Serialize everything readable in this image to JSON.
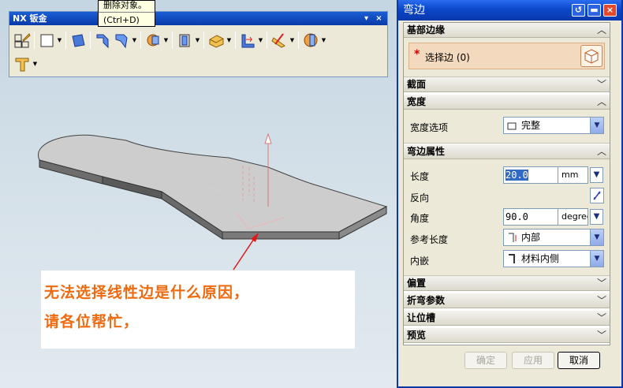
{
  "tooltip": {
    "line1": "删除对象。",
    "line2": "(Ctrl+D)"
  },
  "toolbar": {
    "title": "NX 钣金",
    "controls": [
      "▾",
      "×"
    ],
    "row1_icons": [
      "sketch-icon",
      "tab-icon",
      "flange-icon",
      "contour-flange-icon",
      "lofted-flange-icon",
      "bend-icon",
      "jog-icon",
      "hem-flange-icon",
      "gusset-icon",
      "unbend-icon",
      "rebend-icon",
      "solid-punch-icon"
    ],
    "row2_icons": [
      "convert-sheet-metal-icon"
    ]
  },
  "annotation": {
    "line1": "无法选择线性边是什么原因，",
    "line2": "请各位帮忙，"
  },
  "dialog": {
    "title": "弯边",
    "controls": {
      "reset": "↺",
      "min": "▬",
      "close": "×"
    },
    "sections": {
      "base_edge": {
        "header": "基部边缘",
        "select_edge": "选择边 (0)",
        "required_mark": "*"
      },
      "section": {
        "header": "截面"
      },
      "width": {
        "header": "宽度",
        "option_label": "宽度选项",
        "option_value": "完整"
      },
      "flange_properties": {
        "header": "弯边属性",
        "length_label": "长度",
        "length_value": "20.0",
        "length_unit": "mm",
        "reverse_label": "反向",
        "angle_label": "角度",
        "angle_value": "90.0",
        "angle_unit": "degree",
        "ref_length_label": "参考长度",
        "ref_length_value": "内部",
        "inset_label": "内嵌",
        "inset_value": "材料内侧"
      },
      "offset": {
        "header": "偏置"
      },
      "bend_params": {
        "header": "折弯参数"
      },
      "relief": {
        "header": "让位槽"
      },
      "preview": {
        "header": "预览"
      }
    },
    "buttons": {
      "ok": "确定",
      "apply": "应用",
      "cancel": "取消"
    }
  },
  "colors": {
    "title_blue": "#0b47c9",
    "panel_bg": "#ece9d8",
    "required_star": "#d90000",
    "annotation_text": "#f06a10",
    "annotation_arrow": "#e01818"
  }
}
